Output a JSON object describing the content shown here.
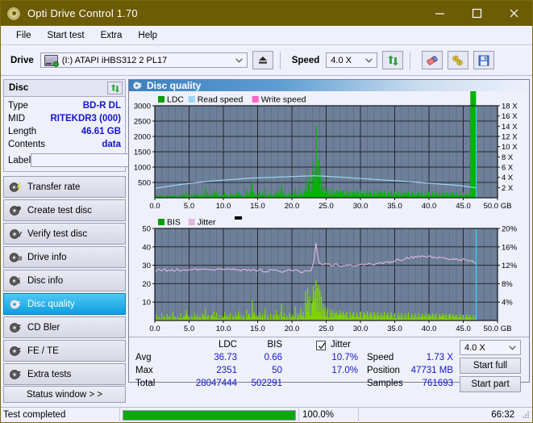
{
  "window": {
    "title": "Opti Drive Control 1.70",
    "icon": "disc-icon",
    "minimize": "minimize-icon",
    "maximize": "maximize-icon",
    "close": "close-icon"
  },
  "menu": {
    "items": [
      {
        "label": "File"
      },
      {
        "label": "Start test"
      },
      {
        "label": "Extra"
      },
      {
        "label": "Help"
      }
    ]
  },
  "toolbar": {
    "drive_label": "Drive",
    "drive_value": "(I:)  ATAPI iHBS312  2 PL17",
    "eject_icon": "eject-icon",
    "speed_label": "Speed",
    "speed_value": "4.0 X",
    "refresh_icon": "refresh-icon",
    "erase_icon": "eraser-icon",
    "tools_icon": "tools-icon",
    "save_icon": "save-icon"
  },
  "disc_panel": {
    "title": "Disc",
    "refresh_icon": "refresh-icon",
    "rows": [
      {
        "key": "Type",
        "value": "BD-R DL"
      },
      {
        "key": "MID",
        "value": "RITEKDR3 (000)"
      },
      {
        "key": "Length",
        "value": "46.61 GB"
      },
      {
        "key": "Contents",
        "value": "data"
      }
    ],
    "label_key": "Label",
    "label_value": "",
    "label_placeholder": "",
    "disc_button_icon": "disc-icon"
  },
  "nav": {
    "items": [
      {
        "label": "Transfer rate",
        "icon": "disc-speed-icon",
        "active": false
      },
      {
        "label": "Create test disc",
        "icon": "disc-write-icon",
        "active": false
      },
      {
        "label": "Verify test disc",
        "icon": "disc-check-icon",
        "active": false
      },
      {
        "label": "Drive info",
        "icon": "drive-info-icon",
        "active": false
      },
      {
        "label": "Disc info",
        "icon": "disc-info-icon",
        "active": false
      },
      {
        "label": "Disc quality",
        "icon": "disc-quality-icon",
        "active": true
      },
      {
        "label": "CD Bler",
        "icon": "disc-bler-icon",
        "active": false
      },
      {
        "label": "FE / TE",
        "icon": "disc-fete-icon",
        "active": false
      },
      {
        "label": "Extra tests",
        "icon": "disc-extra-icon",
        "active": false
      }
    ],
    "status_window": "Status window > >"
  },
  "main": {
    "header_title": "Disc quality",
    "header_icon": "disc-quality-icon"
  },
  "stats": {
    "col_ldc": "LDC",
    "col_bis": "BIS",
    "col_jitter": "Jitter",
    "jitter_checked": true,
    "rows": [
      {
        "name": "Avg",
        "ldc": "36.73",
        "bis": "0.66",
        "jitter": "10.7%"
      },
      {
        "name": "Max",
        "ldc": "2351",
        "bis": "50",
        "jitter": "17.0%"
      },
      {
        "name": "Total",
        "ldc": "28047444",
        "bis": "502291",
        "jitter": ""
      }
    ],
    "speed_label": "Speed",
    "speed_value": "1.73 X",
    "position_label": "Position",
    "position_value": "47731 MB",
    "samples_label": "Samples",
    "samples_value": "761693",
    "speed_select": "4.0 X",
    "start_full": "Start full",
    "start_part": "Start part"
  },
  "statusbar": {
    "message": "Test completed",
    "progress_percent": 100.0,
    "progress_text": "100.0%",
    "time": "66:32"
  },
  "colors": {
    "title_bar": "#6d5c06",
    "accent_blue": "#1515cc",
    "plot_bg": "#6e7f99",
    "ldc_green": "#00b400",
    "read_speed": "#9bd7f2",
    "write_speed": "#ff66cc",
    "jitter_pink": "#e0b6e0",
    "bis_green": "#7fd400",
    "marker_cyan": "#3fd0f0",
    "progress_green": "#0aa80a",
    "active_nav": "#0d9fe0"
  },
  "chart_data": [
    {
      "type": "area",
      "id": "ldc-chart",
      "title": "LDC / Read speed",
      "xlabel": "GB",
      "ylabel": "",
      "xlim": [
        0.0,
        50.0
      ],
      "xticks": [
        0.0,
        5.0,
        10.0,
        15.0,
        20.0,
        25.0,
        30.0,
        35.0,
        40.0,
        45.0,
        50.0
      ],
      "xticklabels": [
        "0.0",
        "5.0",
        "10.0",
        "15.0",
        "20.0",
        "25.0",
        "30.0",
        "35.0",
        "40.0",
        "45.0",
        "50.0 GB"
      ],
      "ylim": [
        0,
        3000
      ],
      "yticks": [
        500,
        1000,
        1500,
        2000,
        2500,
        3000
      ],
      "yticklabels": [
        "500",
        "1000",
        "1500",
        "2000",
        "2500",
        "3000"
      ],
      "y2lim": [
        0,
        18
      ],
      "y2ticks": [
        2,
        4,
        6,
        8,
        10,
        12,
        14,
        16,
        18
      ],
      "y2ticklabels": [
        "2 X",
        "4 X",
        "6 X",
        "8 X",
        "10 X",
        "12 X",
        "14 X",
        "16 X",
        "18 X"
      ],
      "grid": true,
      "legend": [
        {
          "name": "LDC",
          "color": "#00a000"
        },
        {
          "name": "Read speed",
          "color": "#9bd7f2"
        },
        {
          "name": "Write speed",
          "color": "#ff66cc"
        }
      ],
      "marker_x": 46.9,
      "series": [
        {
          "name": "LDC",
          "type": "impulse",
          "color": "#00b400",
          "x": [
            0.2,
            0.6,
            1.0,
            1.4,
            1.8,
            2.2,
            2.6,
            3.0,
            3.4,
            3.8,
            4.2,
            4.6,
            5.0,
            5.4,
            5.8,
            6.2,
            6.6,
            7.0,
            7.4,
            7.8,
            8.2,
            8.6,
            9.0,
            9.4,
            9.8,
            10.2,
            10.6,
            11.0,
            11.4,
            11.8,
            12.2,
            12.6,
            13.0,
            13.4,
            13.8,
            14.2,
            14.6,
            14.9,
            15.3,
            15.7,
            16.1,
            16.5,
            16.9,
            17.3,
            17.7,
            18.1,
            18.5,
            18.9,
            19.3,
            19.7,
            20.1,
            20.5,
            20.9,
            21.3,
            21.7,
            22.0,
            22.3,
            22.6,
            22.9,
            23.1,
            23.3,
            23.5,
            23.7,
            23.9,
            24.1,
            24.3,
            24.6,
            24.9,
            25.2,
            25.6,
            26.0,
            26.5,
            27.0,
            27.5,
            28.0,
            28.5,
            29.0,
            29.5,
            30.0,
            30.5,
            31.0,
            31.5,
            32.0,
            32.5,
            33.0,
            33.5,
            34.0,
            34.5,
            35.0,
            35.5,
            36.0,
            36.5,
            37.0,
            37.5,
            38.0,
            38.5,
            39.0,
            39.5,
            40.0,
            40.5,
            41.0,
            41.5,
            42.0,
            42.5,
            43.0,
            43.5,
            44.0,
            44.5,
            45.0,
            45.5,
            46.0,
            46.5,
            46.8
          ],
          "y": [
            90,
            70,
            110,
            60,
            95,
            80,
            150,
            70,
            60,
            120,
            90,
            200,
            70,
            90,
            140,
            110,
            80,
            130,
            330,
            100,
            90,
            260,
            160,
            110,
            90,
            180,
            100,
            150,
            90,
            130,
            200,
            110,
            90,
            250,
            140,
            520,
            110,
            90,
            170,
            120,
            280,
            100,
            130,
            90,
            220,
            110,
            430,
            150,
            90,
            170,
            120,
            330,
            110,
            260,
            180,
            690,
            950,
            700,
            420,
            1180,
            880,
            2351,
            1000,
            1250,
            950,
            700,
            420,
            360,
            300,
            290,
            260,
            250,
            280,
            240,
            250,
            220,
            240,
            230,
            250,
            220,
            240,
            230,
            220,
            240,
            210,
            230,
            200,
            220,
            210,
            200,
            230,
            190,
            210,
            200,
            190,
            210,
            180,
            200,
            190,
            180,
            200,
            170,
            190,
            180,
            170,
            190,
            160,
            180,
            170,
            160,
            150
          ]
        },
        {
          "name": "Read speed",
          "type": "line",
          "color": "#9bd7f2",
          "axis": "y2",
          "x": [
            0.0,
            1.0,
            2.0,
            3.0,
            4.0,
            5.0,
            6.0,
            7.0,
            8.0,
            9.0,
            10.0,
            11.0,
            12.0,
            13.0,
            14.0,
            15.0,
            16.0,
            17.0,
            18.0,
            19.0,
            20.0,
            21.0,
            22.0,
            23.0,
            23.4,
            24.0,
            25.0,
            26.0,
            27.0,
            28.0,
            29.0,
            30.0,
            31.0,
            32.0,
            33.0,
            34.0,
            35.0,
            36.0,
            37.0,
            38.0,
            39.0,
            40.0,
            41.0,
            42.0,
            43.0,
            44.0,
            45.0,
            46.0,
            46.85
          ],
          "y": [
            1.85,
            2.05,
            2.25,
            2.45,
            2.65,
            2.8,
            2.95,
            3.1,
            3.25,
            3.35,
            3.45,
            3.55,
            3.65,
            3.75,
            3.85,
            3.9,
            3.95,
            4.0,
            4.05,
            4.1,
            4.15,
            4.2,
            4.25,
            4.28,
            4.3,
            4.25,
            4.2,
            4.12,
            4.05,
            3.95,
            3.85,
            3.78,
            3.7,
            3.6,
            3.5,
            3.42,
            3.35,
            3.25,
            3.15,
            3.05,
            2.95,
            2.85,
            2.75,
            2.65,
            2.55,
            2.45,
            2.3,
            2.1,
            1.95
          ]
        }
      ]
    },
    {
      "type": "area",
      "id": "bis-chart",
      "title": "BIS / Jitter",
      "xlabel": "GB",
      "ylabel": "",
      "xlim": [
        0.0,
        50.0
      ],
      "xticks": [
        0.0,
        5.0,
        10.0,
        15.0,
        20.0,
        25.0,
        30.0,
        35.0,
        40.0,
        45.0,
        50.0
      ],
      "xticklabels": [
        "0.0",
        "5.0",
        "10.0",
        "15.0",
        "20.0",
        "25.0",
        "30.0",
        "35.0",
        "40.0",
        "45.0",
        "50.0 GB"
      ],
      "ylim": [
        0,
        50
      ],
      "yticks": [
        10,
        20,
        30,
        40,
        50
      ],
      "yticklabels": [
        "10",
        "20",
        "30",
        "40",
        "50"
      ],
      "y2lim": [
        0,
        20
      ],
      "y2ticks": [
        4,
        8,
        12,
        16,
        20
      ],
      "y2ticklabels": [
        "4%",
        "8%",
        "12%",
        "16%",
        "20%"
      ],
      "grid": true,
      "legend": [
        {
          "name": "BIS",
          "color": "#00a000"
        },
        {
          "name": "Jitter",
          "color": "#e0b6e0"
        }
      ],
      "marker_x": 46.9,
      "series": [
        {
          "name": "BIS",
          "type": "impulse",
          "color": "#7fd400",
          "x": [
            0.2,
            0.6,
            1.0,
            1.4,
            1.8,
            2.2,
            2.6,
            3.0,
            3.4,
            3.8,
            4.2,
            4.6,
            5.0,
            5.4,
            5.8,
            6.2,
            6.6,
            7.0,
            7.4,
            7.8,
            8.2,
            8.6,
            9.0,
            9.4,
            9.8,
            10.2,
            10.6,
            11.0,
            11.4,
            11.8,
            12.2,
            12.6,
            13.0,
            13.4,
            13.8,
            14.2,
            14.6,
            14.9,
            15.3,
            15.7,
            16.1,
            16.5,
            16.9,
            17.3,
            17.7,
            18.1,
            18.5,
            18.9,
            19.3,
            19.7,
            20.1,
            20.5,
            20.9,
            21.3,
            21.7,
            22.0,
            22.3,
            22.6,
            22.9,
            23.1,
            23.3,
            23.5,
            23.7,
            23.9,
            24.1,
            24.3,
            24.6,
            24.9,
            25.2,
            25.6,
            26.0,
            26.5,
            27.0,
            27.5,
            28.0,
            28.5,
            29.0,
            29.5,
            30.0,
            30.5,
            31.0,
            31.5,
            32.0,
            32.5,
            33.0,
            33.5,
            34.0,
            34.5,
            35.0,
            35.5,
            36.0,
            36.5,
            37.0,
            37.5,
            38.0,
            38.5,
            39.0,
            39.5,
            40.0,
            40.5,
            41.0,
            41.5,
            42.0,
            42.5,
            43.0,
            43.5,
            44.0,
            44.5,
            45.0,
            45.5,
            46.0,
            46.5,
            46.8
          ],
          "y": [
            3.0,
            2.0,
            4.0,
            2.2,
            3.5,
            2.5,
            4.5,
            2.0,
            2.2,
            3.8,
            2.6,
            5.5,
            2.0,
            2.8,
            4.0,
            3.2,
            2.4,
            3.8,
            6.5,
            2.8,
            2.6,
            5.0,
            4.2,
            3.0,
            2.4,
            4.5,
            3.0,
            4.0,
            2.6,
            3.6,
            5.0,
            3.0,
            2.6,
            6.0,
            3.8,
            11.0,
            3.0,
            2.6,
            4.4,
            3.2,
            7.0,
            2.8,
            3.6,
            2.6,
            5.5,
            3.0,
            9.0,
            4.0,
            2.6,
            4.4,
            3.2,
            7.5,
            3.0,
            6.5,
            4.6,
            16.0,
            18.0,
            13.0,
            9.0,
            19.0,
            16.0,
            22.0,
            17.5,
            19.5,
            16.5,
            13.0,
            9.0,
            7.5,
            6.5,
            6.0,
            5.5,
            5.0,
            5.5,
            4.8,
            5.0,
            4.5,
            4.8,
            4.4,
            4.8,
            4.5,
            5.0,
            4.3,
            4.6,
            4.4,
            4.2,
            4.6,
            4.0,
            4.4,
            3.9,
            4.2,
            4.0,
            3.8,
            4.4,
            3.7,
            4.1,
            3.9,
            3.7,
            4.1,
            3.5,
            3.9,
            3.7,
            3.5,
            3.9,
            3.3,
            3.7,
            3.5,
            3.3,
            3.7,
            3.1,
            3.5,
            3.3,
            3.1,
            2.9
          ]
        },
        {
          "name": "Jitter",
          "type": "line",
          "color": "#e0b6e0",
          "axis": "y2",
          "x": [
            0.0,
            1.0,
            2.0,
            3.0,
            4.0,
            5.0,
            6.0,
            7.0,
            8.0,
            9.0,
            10.0,
            11.0,
            12.0,
            13.0,
            14.0,
            15.0,
            16.0,
            17.0,
            18.0,
            19.0,
            20.0,
            21.0,
            22.0,
            22.8,
            23.2,
            23.5,
            23.7,
            24.0,
            24.5,
            25.0,
            26.0,
            27.0,
            28.0,
            29.0,
            30.0,
            31.0,
            32.0,
            33.0,
            34.0,
            35.0,
            36.0,
            37.0,
            38.0,
            39.0,
            40.0,
            41.0,
            42.0,
            43.0,
            44.0,
            45.0,
            46.0,
            46.85
          ],
          "y": [
            10.9,
            11.0,
            10.9,
            11.0,
            10.9,
            11.0,
            11.1,
            11.2,
            11.0,
            11.1,
            11.0,
            11.1,
            11.0,
            10.9,
            11.0,
            10.9,
            10.8,
            10.8,
            10.7,
            10.7,
            10.8,
            10.7,
            10.6,
            10.6,
            13.0,
            17.0,
            14.6,
            12.6,
            12.3,
            12.3,
            12.1,
            12.0,
            12.0,
            12.1,
            12.1,
            12.2,
            12.2,
            12.4,
            12.6,
            13.0,
            13.3,
            13.6,
            13.8,
            13.9,
            13.8,
            13.6,
            13.6,
            13.5,
            13.3,
            13.2,
            13.0,
            12.5
          ]
        }
      ]
    }
  ]
}
